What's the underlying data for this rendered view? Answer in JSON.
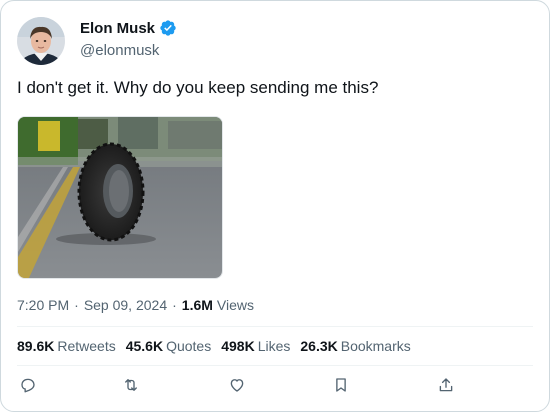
{
  "author": {
    "display_name": "Elon Musk",
    "handle": "@elonmusk",
    "verified_icon": "verified-badge-icon",
    "verified_color": "#1d9bf0"
  },
  "tweet": {
    "text": "I don't get it. Why do you keep sending me this?",
    "time": "7:20 PM",
    "date": "Sep 09, 2024",
    "views_count": "1.6M",
    "views_label": "Views"
  },
  "stats": [
    {
      "count": "89.6K",
      "label": "Retweets"
    },
    {
      "count": "45.6K",
      "label": "Quotes"
    },
    {
      "count": "498K",
      "label": "Likes"
    },
    {
      "count": "26.3K",
      "label": "Bookmarks"
    }
  ],
  "actions": [
    "reply-icon",
    "retweet-icon",
    "like-icon",
    "bookmark-icon",
    "share-icon"
  ],
  "colors": {
    "text_primary": "#0f1419",
    "text_secondary": "#536471",
    "accent": "#1d9bf0",
    "border": "#cfd9de"
  }
}
